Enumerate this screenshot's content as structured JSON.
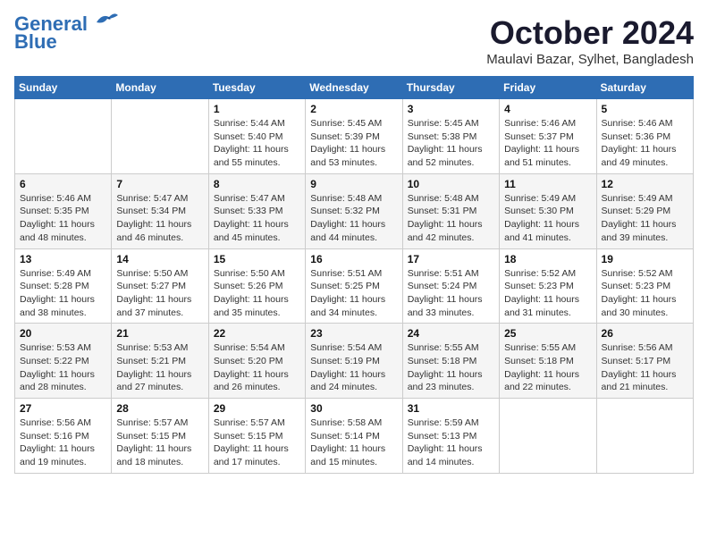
{
  "header": {
    "logo_line1": "General",
    "logo_line2": "Blue",
    "month": "October 2024",
    "location": "Maulavi Bazar, Sylhet, Bangladesh"
  },
  "weekdays": [
    "Sunday",
    "Monday",
    "Tuesday",
    "Wednesday",
    "Thursday",
    "Friday",
    "Saturday"
  ],
  "weeks": [
    [
      {
        "day": "",
        "info": ""
      },
      {
        "day": "",
        "info": ""
      },
      {
        "day": "1",
        "info": "Sunrise: 5:44 AM\nSunset: 5:40 PM\nDaylight: 11 hours and 55 minutes."
      },
      {
        "day": "2",
        "info": "Sunrise: 5:45 AM\nSunset: 5:39 PM\nDaylight: 11 hours and 53 minutes."
      },
      {
        "day": "3",
        "info": "Sunrise: 5:45 AM\nSunset: 5:38 PM\nDaylight: 11 hours and 52 minutes."
      },
      {
        "day": "4",
        "info": "Sunrise: 5:46 AM\nSunset: 5:37 PM\nDaylight: 11 hours and 51 minutes."
      },
      {
        "day": "5",
        "info": "Sunrise: 5:46 AM\nSunset: 5:36 PM\nDaylight: 11 hours and 49 minutes."
      }
    ],
    [
      {
        "day": "6",
        "info": "Sunrise: 5:46 AM\nSunset: 5:35 PM\nDaylight: 11 hours and 48 minutes."
      },
      {
        "day": "7",
        "info": "Sunrise: 5:47 AM\nSunset: 5:34 PM\nDaylight: 11 hours and 46 minutes."
      },
      {
        "day": "8",
        "info": "Sunrise: 5:47 AM\nSunset: 5:33 PM\nDaylight: 11 hours and 45 minutes."
      },
      {
        "day": "9",
        "info": "Sunrise: 5:48 AM\nSunset: 5:32 PM\nDaylight: 11 hours and 44 minutes."
      },
      {
        "day": "10",
        "info": "Sunrise: 5:48 AM\nSunset: 5:31 PM\nDaylight: 11 hours and 42 minutes."
      },
      {
        "day": "11",
        "info": "Sunrise: 5:49 AM\nSunset: 5:30 PM\nDaylight: 11 hours and 41 minutes."
      },
      {
        "day": "12",
        "info": "Sunrise: 5:49 AM\nSunset: 5:29 PM\nDaylight: 11 hours and 39 minutes."
      }
    ],
    [
      {
        "day": "13",
        "info": "Sunrise: 5:49 AM\nSunset: 5:28 PM\nDaylight: 11 hours and 38 minutes."
      },
      {
        "day": "14",
        "info": "Sunrise: 5:50 AM\nSunset: 5:27 PM\nDaylight: 11 hours and 37 minutes."
      },
      {
        "day": "15",
        "info": "Sunrise: 5:50 AM\nSunset: 5:26 PM\nDaylight: 11 hours and 35 minutes."
      },
      {
        "day": "16",
        "info": "Sunrise: 5:51 AM\nSunset: 5:25 PM\nDaylight: 11 hours and 34 minutes."
      },
      {
        "day": "17",
        "info": "Sunrise: 5:51 AM\nSunset: 5:24 PM\nDaylight: 11 hours and 33 minutes."
      },
      {
        "day": "18",
        "info": "Sunrise: 5:52 AM\nSunset: 5:23 PM\nDaylight: 11 hours and 31 minutes."
      },
      {
        "day": "19",
        "info": "Sunrise: 5:52 AM\nSunset: 5:23 PM\nDaylight: 11 hours and 30 minutes."
      }
    ],
    [
      {
        "day": "20",
        "info": "Sunrise: 5:53 AM\nSunset: 5:22 PM\nDaylight: 11 hours and 28 minutes."
      },
      {
        "day": "21",
        "info": "Sunrise: 5:53 AM\nSunset: 5:21 PM\nDaylight: 11 hours and 27 minutes."
      },
      {
        "day": "22",
        "info": "Sunrise: 5:54 AM\nSunset: 5:20 PM\nDaylight: 11 hours and 26 minutes."
      },
      {
        "day": "23",
        "info": "Sunrise: 5:54 AM\nSunset: 5:19 PM\nDaylight: 11 hours and 24 minutes."
      },
      {
        "day": "24",
        "info": "Sunrise: 5:55 AM\nSunset: 5:18 PM\nDaylight: 11 hours and 23 minutes."
      },
      {
        "day": "25",
        "info": "Sunrise: 5:55 AM\nSunset: 5:18 PM\nDaylight: 11 hours and 22 minutes."
      },
      {
        "day": "26",
        "info": "Sunrise: 5:56 AM\nSunset: 5:17 PM\nDaylight: 11 hours and 21 minutes."
      }
    ],
    [
      {
        "day": "27",
        "info": "Sunrise: 5:56 AM\nSunset: 5:16 PM\nDaylight: 11 hours and 19 minutes."
      },
      {
        "day": "28",
        "info": "Sunrise: 5:57 AM\nSunset: 5:15 PM\nDaylight: 11 hours and 18 minutes."
      },
      {
        "day": "29",
        "info": "Sunrise: 5:57 AM\nSunset: 5:15 PM\nDaylight: 11 hours and 17 minutes."
      },
      {
        "day": "30",
        "info": "Sunrise: 5:58 AM\nSunset: 5:14 PM\nDaylight: 11 hours and 15 minutes."
      },
      {
        "day": "31",
        "info": "Sunrise: 5:59 AM\nSunset: 5:13 PM\nDaylight: 11 hours and 14 minutes."
      },
      {
        "day": "",
        "info": ""
      },
      {
        "day": "",
        "info": ""
      }
    ]
  ]
}
